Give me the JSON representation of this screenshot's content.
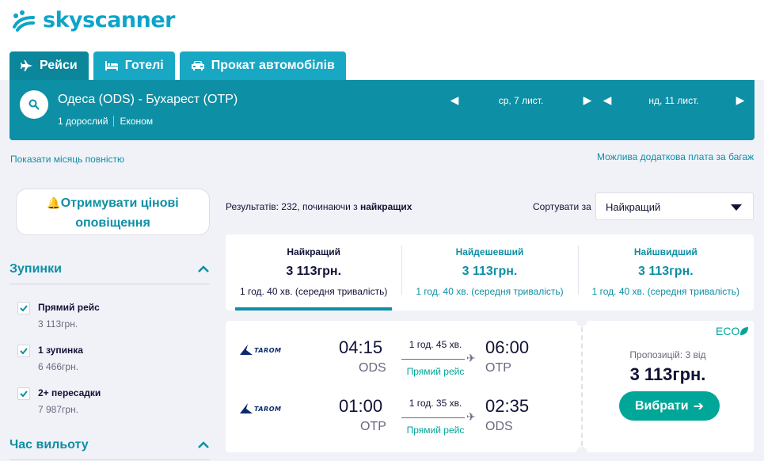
{
  "brand": {
    "name": "skyscanner"
  },
  "tabs": [
    {
      "label": "Рейси",
      "icon": "plane-icon",
      "active": true
    },
    {
      "label": "Готелі",
      "icon": "bed-icon",
      "active": false
    },
    {
      "label": "Прокат автомобілів",
      "icon": "car-icon",
      "active": false
    }
  ],
  "search": {
    "route": "Одеса (ODS) - Бухарест (OTP)",
    "passengers": "1 дорослий",
    "cabin": "Економ",
    "depart_date": "ср, 7 лист.",
    "return_date": "нд, 11 лист."
  },
  "links": {
    "whole_month": "Показати місяць повністю",
    "baggage": "Можлива додаткова плата за багаж"
  },
  "sidebar": {
    "alert_line1": "Отримувати цінові",
    "alert_line2": "оповіщення",
    "stops_title": "Зупинки",
    "stops": [
      {
        "label": "Прямий рейс",
        "price": "3 113грн.",
        "checked": true
      },
      {
        "label": "1 зупинка",
        "price": "6 466грн.",
        "checked": true
      },
      {
        "label": "2+ пересадки",
        "price": "7 987грн.",
        "checked": true
      }
    ],
    "departure_title": "Час вильоту"
  },
  "results": {
    "prefix": "Результатів: 232, починаючи з ",
    "emphasis": "найкращих",
    "sort_label": "Сортувати за",
    "sort_value": "Найкращий"
  },
  "sort_tabs": [
    {
      "title": "Найкращий",
      "price": "3 113грн.",
      "duration": "1 год. 40 хв. (середня тривалість)",
      "active": true
    },
    {
      "title": "Найдешевший",
      "price": "3 113грн.",
      "duration": "1 год. 40 хв. (середня тривалість)",
      "active": false
    },
    {
      "title": "Найшвидший",
      "price": "3 113грн.",
      "duration": "1 год. 40 хв. (середня тривалість)",
      "active": false
    }
  ],
  "result_card": {
    "airline": "TAROM",
    "eco_label": "ECO",
    "legs": [
      {
        "dep_time": "04:15",
        "dep_code": "ODS",
        "arr_time": "06:00",
        "arr_code": "OTP",
        "duration": "1 год. 45 хв.",
        "stops": "Прямий рейс"
      },
      {
        "dep_time": "01:00",
        "dep_code": "OTP",
        "arr_time": "02:35",
        "arr_code": "ODS",
        "duration": "1 год. 35 хв.",
        "stops": "Прямий рейс"
      }
    ],
    "offers": "Пропозицій: 3 від",
    "price": "3 113грн.",
    "select_label": "Вибрати"
  },
  "colors": {
    "brand": "#0ea4c9",
    "bar": "#0d8fa5",
    "green": "#00a698"
  }
}
